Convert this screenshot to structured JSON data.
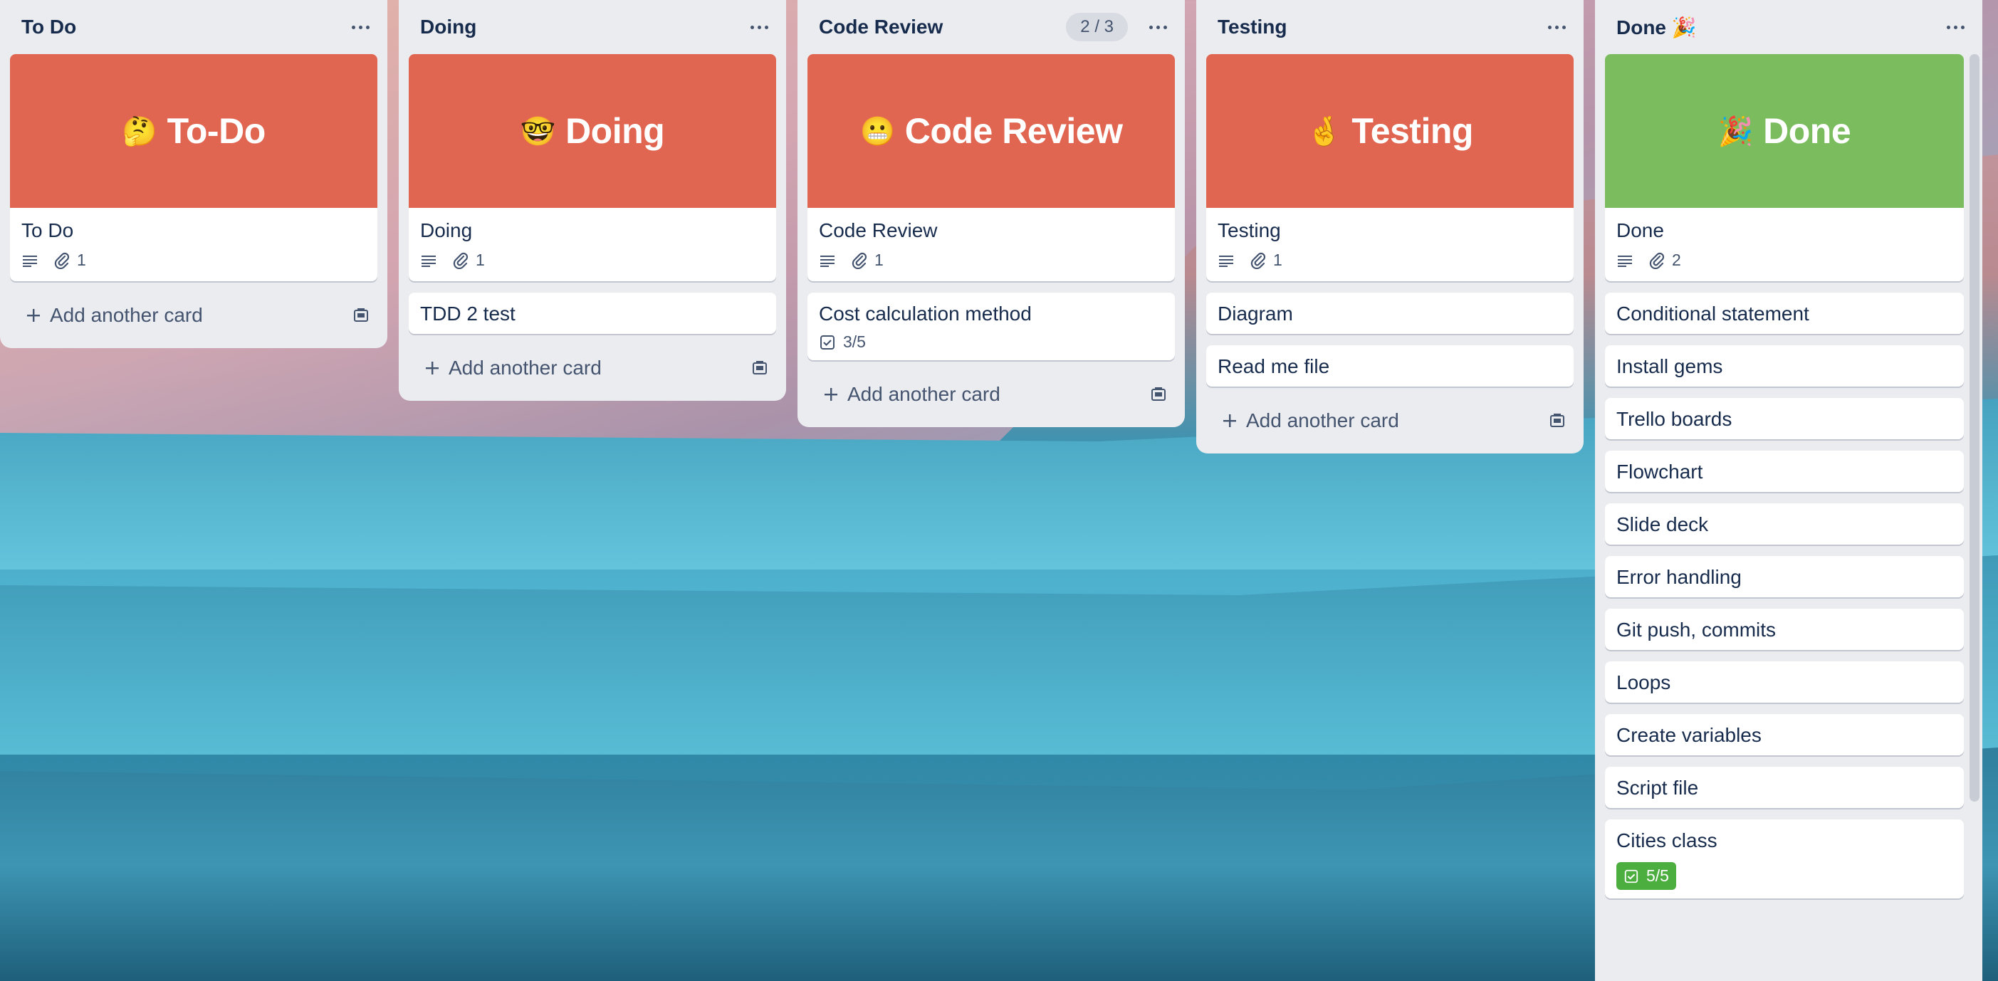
{
  "lists": [
    {
      "title": "To Do",
      "cards": [
        {
          "cover_title": "To-Do",
          "cover_emoji": "🤔",
          "title": "To Do",
          "attachments": "1"
        }
      ],
      "add_label": "Add another card"
    },
    {
      "title": "Doing",
      "cards": [
        {
          "cover_title": "Doing",
          "cover_emoji": "🤓",
          "title": "Doing",
          "attachments": "1"
        },
        {
          "title": "TDD 2 test"
        }
      ],
      "add_label": "Add another card"
    },
    {
      "title": "Code Review",
      "count": "2 / 3",
      "cards": [
        {
          "cover_title": "Code Review",
          "cover_emoji": "😬",
          "title": "Code Review",
          "attachments": "1"
        },
        {
          "title": "Cost calculation method",
          "checklist": "3/5"
        }
      ],
      "add_label": "Add another card"
    },
    {
      "title": "Testing",
      "cards": [
        {
          "cover_title": "Testing",
          "cover_emoji": "🤞",
          "title": "Testing",
          "attachments": "1"
        },
        {
          "title": "Diagram"
        },
        {
          "title": "Read me file"
        }
      ],
      "add_label": "Add another card"
    },
    {
      "title": "Done 🎉",
      "cards": [
        {
          "cover_title": "Done",
          "cover_emoji": "🎉",
          "title": "Done",
          "attachments": "2"
        },
        {
          "title": "Conditional statement"
        },
        {
          "title": "Install gems"
        },
        {
          "title": "Trello boards"
        },
        {
          "title": "Flowchart"
        },
        {
          "title": "Slide deck"
        },
        {
          "title": "Error handling"
        },
        {
          "title": "Git push, commits"
        },
        {
          "title": "Loops"
        },
        {
          "title": "Create variables"
        },
        {
          "title": "Script file"
        },
        {
          "title": "Cities class",
          "checklist": "5/5"
        }
      ]
    }
  ],
  "colors": {
    "cover_red": "#e06652",
    "cover_green": "#7bbd5e",
    "list_bg": "#ebecf0",
    "text_primary": "#172b4d",
    "text_secondary": "#44546f",
    "checklist_complete": "#4cae3e"
  },
  "icons": {
    "description": "description-icon",
    "attachment": "paperclip-icon",
    "checklist": "checklist-icon",
    "add": "plus-icon",
    "template": "card-template-icon",
    "menu": "more-dots-icon"
  }
}
